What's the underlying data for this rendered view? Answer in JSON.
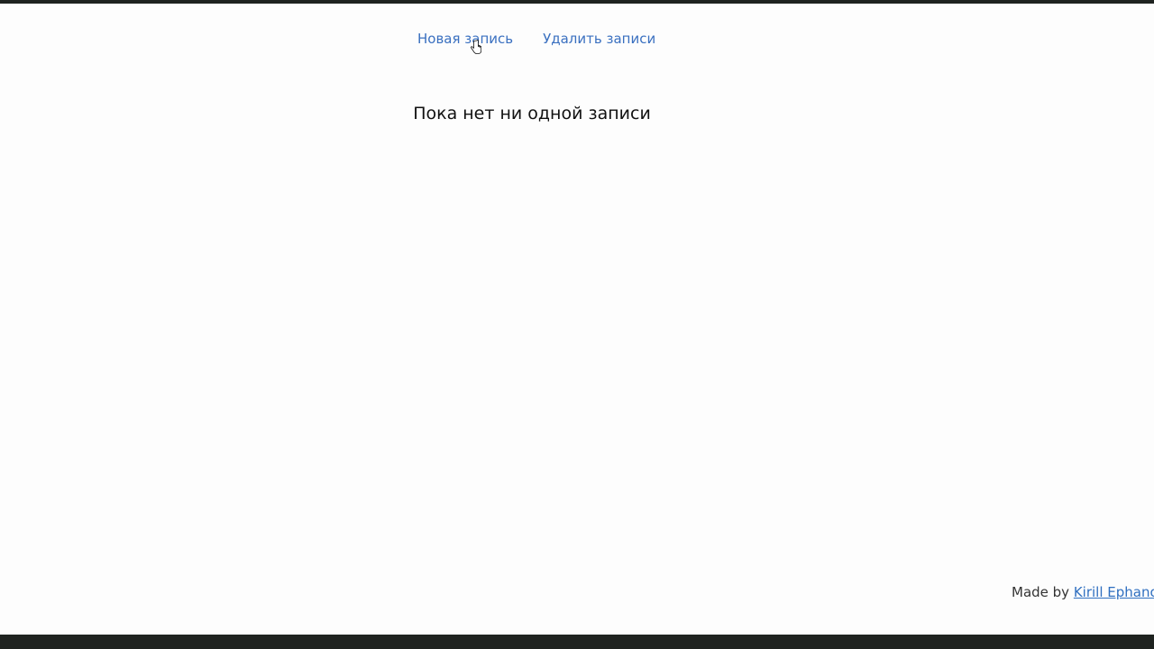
{
  "nav": {
    "new_entry": "Новая запись",
    "delete_entries": "Удалить записи"
  },
  "main": {
    "empty_message": "Пока нет ни одной записи"
  },
  "footer": {
    "made_by": "Made by",
    "author": "Kirill Ephano"
  },
  "colors": {
    "link": "#3a70c0",
    "frame": "#1f2320"
  },
  "icons": {
    "cursor": "hand-pointer-icon"
  }
}
